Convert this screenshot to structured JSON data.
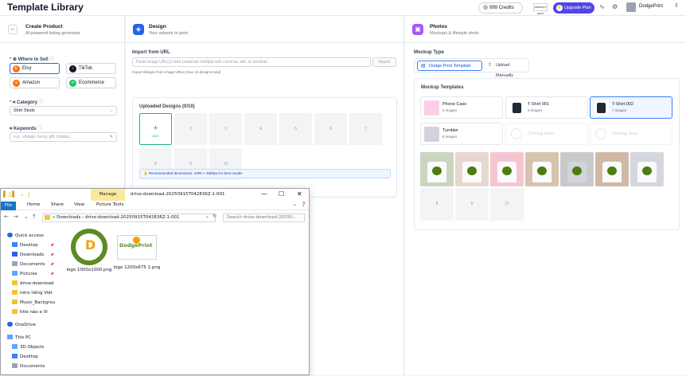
{
  "header": {
    "title": "Template Library",
    "credits": "999 Credits",
    "ph_badge": "PRODUCT HUNT",
    "upgrade": "Upgrade Plan",
    "profile_name": "DodgePrint"
  },
  "left": {
    "title": "Create Product",
    "subtitle": "AI-powered listing generator",
    "where_label": "Where to Sell",
    "marketplaces": [
      {
        "label": "Etsy",
        "color": "#f97316",
        "glyph": "E"
      },
      {
        "label": "TikTok",
        "color": "#111827",
        "glyph": "♪"
      },
      {
        "label": "Amazon",
        "color": "#f97316",
        "glyph": "a"
      },
      {
        "label": "Ecommerce",
        "color": "#22c55e",
        "glyph": "e"
      }
    ],
    "category_label": "Category",
    "category_value": "Shirt Studs",
    "keywords_label": "Keywords",
    "keywords_placeholder": "e.g., vintage, funny, gift, holiday..."
  },
  "design": {
    "title": "Design",
    "subtitle": "Your artwork to print",
    "import_label": "Import from URL",
    "url_placeholder": "Paste image URL(s) here (separate multiple with commas, tab, or newline)",
    "import_button": "Import",
    "import_hint": "Import designs from image URLs (max 10 designs total)",
    "uploaded_label": "Uploaded Designs (0/10)",
    "add_label": "ADD",
    "slots": [
      "2",
      "3",
      "4",
      "5",
      "6",
      "7",
      "8",
      "9",
      "10"
    ],
    "recommended": "Recommended dimensions: 4200 × 4800px for best results"
  },
  "photos": {
    "title": "Photos",
    "subtitle": "Mockups & lifestyle shots",
    "mockup_type_label": "Mockup Type",
    "type_buttons": [
      "Dodge Print Template",
      "Upload Manually"
    ],
    "templates_label": "Mockup Templates",
    "templates": [
      {
        "name": "Phone Case",
        "count": "6 images",
        "thumb": "#fbcfe8"
      },
      {
        "name": "T-Shirt 001",
        "count": "6 images",
        "thumb": "#1f2937"
      },
      {
        "name": "T-Shirt 002",
        "count": "7 images",
        "thumb": "#1f2937"
      },
      {
        "name": "Tumbler",
        "count": "6 images",
        "thumb": "#d1d5db"
      }
    ],
    "coming_soon": "Coming Soon",
    "gallery_bg": [
      "#cbd5c0",
      "#e7d8cf",
      "#f5c6d2",
      "#d6c4ae",
      "#c8c9cc",
      "#cfb9a6",
      "#d4d8de"
    ],
    "empty_slots": [
      "8",
      "9",
      "10"
    ]
  },
  "explorer": {
    "manage": "Manage",
    "path_title": "drive-download-20250915T042836Z-1-001",
    "ribbon_tabs": [
      "File",
      "Home",
      "Share",
      "View",
      "Picture Tools"
    ],
    "address": "« Downloads › drive-download-20250915T042836Z-1-001",
    "search_placeholder": "Search drive-download-20250...",
    "nav": [
      {
        "label": "Quick access",
        "color": "#2563eb"
      },
      {
        "label": "Desktop",
        "color": "#3b82f6"
      },
      {
        "label": "Downloads",
        "color": "#2563eb"
      },
      {
        "label": "Documents",
        "color": "#9ca3af"
      },
      {
        "label": "Pictures",
        "color": "#60a5fa"
      },
      {
        "label": "drive-download",
        "color": "#f4c430"
      },
      {
        "label": "intro tiếng Việt",
        "color": "#f4c430"
      },
      {
        "label": "Music_Backgrou",
        "color": "#f4c430"
      },
      {
        "label": "title nảo e Vi",
        "color": "#f4c430"
      },
      {
        "label": "OneDrive",
        "color": "#2563eb"
      },
      {
        "label": "This PC",
        "color": "#60a5fa"
      },
      {
        "label": "3D Objects",
        "color": "#60a5fa"
      },
      {
        "label": "Desktop",
        "color": "#3b82f6"
      },
      {
        "label": "Documents",
        "color": "#9ca3af"
      }
    ],
    "files": [
      {
        "name": "logo 1000x1000.png"
      },
      {
        "name": "logo 1200x675 1.png"
      }
    ],
    "logo_text": "DodgePrint"
  }
}
